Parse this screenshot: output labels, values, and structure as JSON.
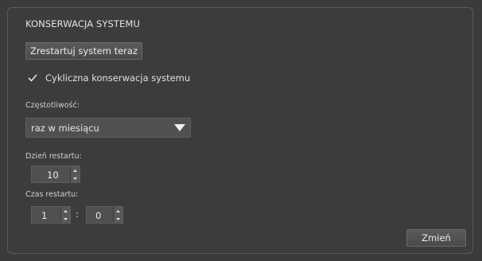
{
  "section": {
    "title": "KONSERWACJA SYSTEMU"
  },
  "buttons": {
    "restart_now": "Zrestartuj system teraz",
    "change": "Zmień"
  },
  "checkbox": {
    "label": "Cykliczna konserwacja systemu",
    "checked": true
  },
  "frequency": {
    "label": "Częstotliwość:",
    "value": "raz w miesiącu"
  },
  "restart_day": {
    "label": "Dzień restartu:",
    "value": "10"
  },
  "restart_time": {
    "label": "Czas restartu:",
    "hour": "1",
    "separator": ":",
    "minute": "0"
  },
  "icons": {
    "checkbox": "checkmark-icon",
    "dropdown": "triangle-down-icon",
    "spin_up": "chevron-up-icon",
    "spin_down": "chevron-down-icon"
  },
  "colors": {
    "background": "#3b3b3b",
    "panel_border": "#5a5a5a",
    "button_bg": "#505050",
    "text": "#e0e0e0"
  }
}
